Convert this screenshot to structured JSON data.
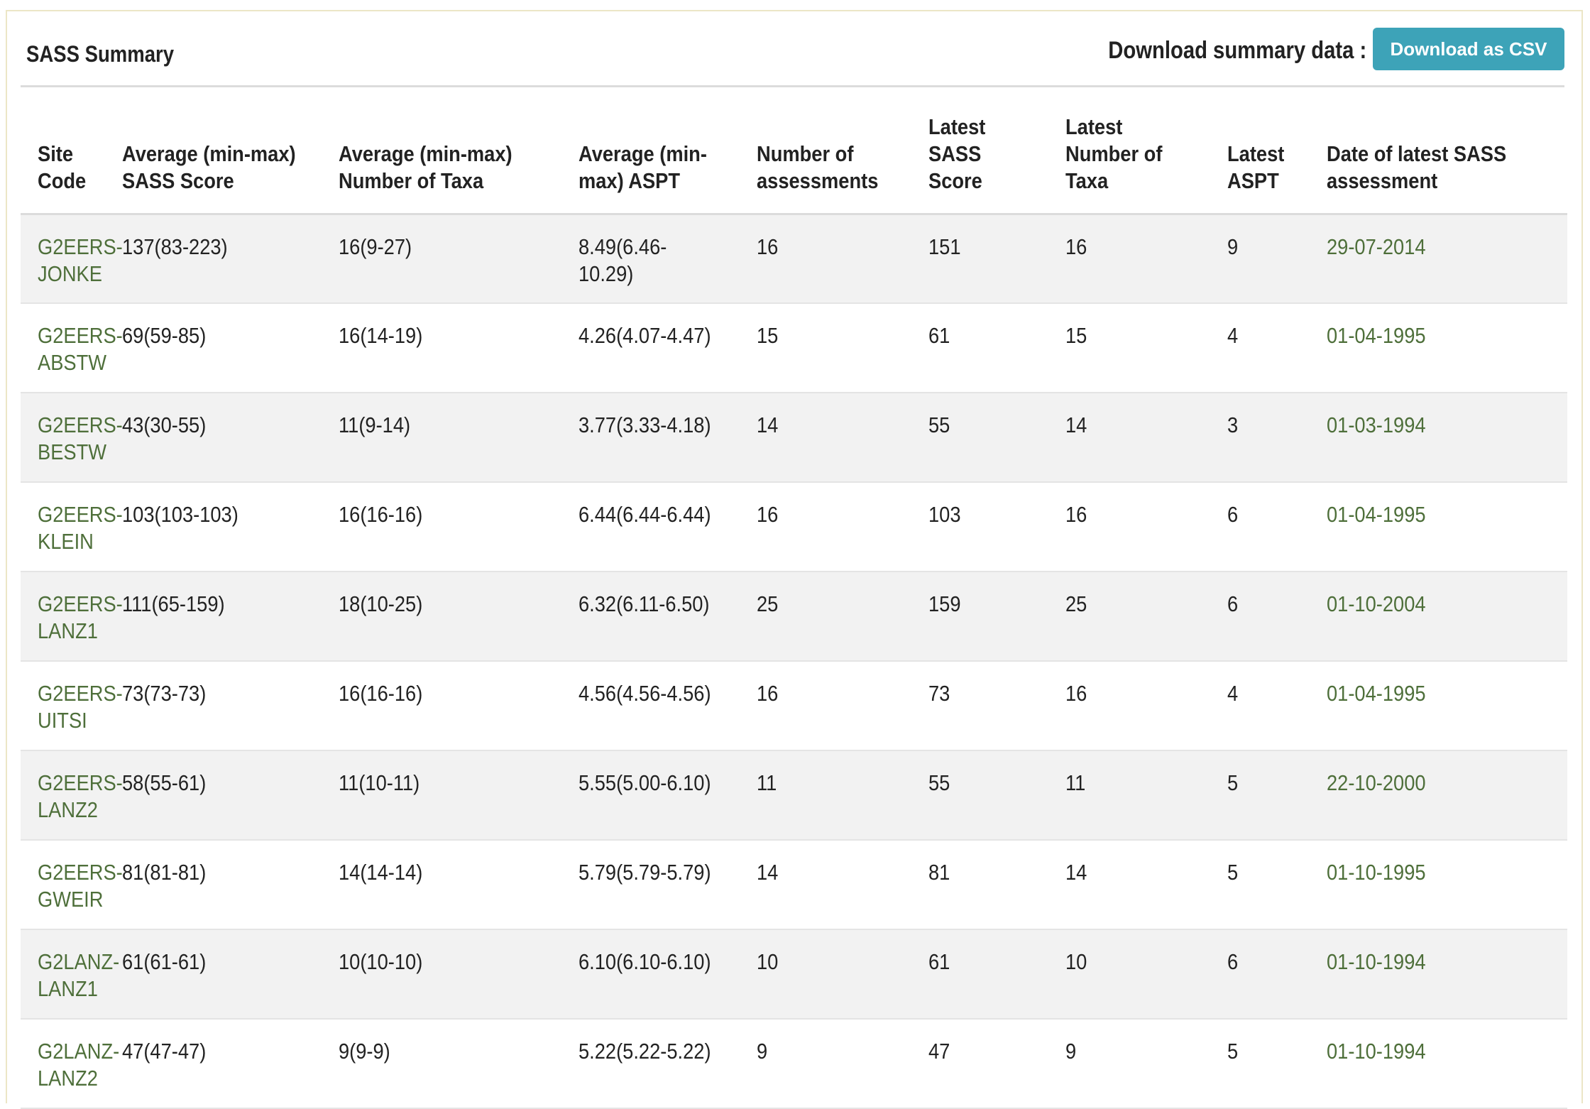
{
  "title": "SASS Summary",
  "download": {
    "label": "Download summary data :",
    "button": "Download as CSV"
  },
  "colors": {
    "link": "#4e6f3a",
    "button": "#3da3b8",
    "row_alt": "#f2f2f2"
  },
  "table": {
    "headers": [
      "Site Code",
      "Average (min-max) SASS Score",
      "Average (min-max) Number of Taxa",
      "Average (min-max) ASPT",
      "Number of assessments",
      "Latest SASS Score",
      "Latest Number of Taxa",
      "Latest ASPT",
      "Date of latest SASS assessment"
    ],
    "rows": [
      {
        "site": "G2EERS-JONKE",
        "avg_sass": "137(83-223)",
        "avg_taxa": "16(9-27)",
        "avg_aspt": "8.49(6.46-10.29)",
        "num": "16",
        "latest_sass": "151",
        "latest_taxa": "16",
        "latest_aspt": "9",
        "date": "29-07-2014"
      },
      {
        "site": "G2EERS-ABSTW",
        "avg_sass": "69(59-85)",
        "avg_taxa": "16(14-19)",
        "avg_aspt": "4.26(4.07-4.47)",
        "num": "15",
        "latest_sass": "61",
        "latest_taxa": "15",
        "latest_aspt": "4",
        "date": "01-04-1995"
      },
      {
        "site": "G2EERS-BESTW",
        "avg_sass": "43(30-55)",
        "avg_taxa": "11(9-14)",
        "avg_aspt": "3.77(3.33-4.18)",
        "num": "14",
        "latest_sass": "55",
        "latest_taxa": "14",
        "latest_aspt": "3",
        "date": "01-03-1994"
      },
      {
        "site": "G2EERS-KLEIN",
        "avg_sass": "103(103-103)",
        "avg_taxa": "16(16-16)",
        "avg_aspt": "6.44(6.44-6.44)",
        "num": "16",
        "latest_sass": "103",
        "latest_taxa": "16",
        "latest_aspt": "6",
        "date": "01-04-1995"
      },
      {
        "site": "G2EERS-LANZ1",
        "avg_sass": "111(65-159)",
        "avg_taxa": "18(10-25)",
        "avg_aspt": "6.32(6.11-6.50)",
        "num": "25",
        "latest_sass": "159",
        "latest_taxa": "25",
        "latest_aspt": "6",
        "date": "01-10-2004"
      },
      {
        "site": "G2EERS-UITSI",
        "avg_sass": "73(73-73)",
        "avg_taxa": "16(16-16)",
        "avg_aspt": "4.56(4.56-4.56)",
        "num": "16",
        "latest_sass": "73",
        "latest_taxa": "16",
        "latest_aspt": "4",
        "date": "01-04-1995"
      },
      {
        "site": "G2EERS-LANZ2",
        "avg_sass": "58(55-61)",
        "avg_taxa": "11(10-11)",
        "avg_aspt": "5.55(5.00-6.10)",
        "num": "11",
        "latest_sass": "55",
        "latest_taxa": "11",
        "latest_aspt": "5",
        "date": "22-10-2000"
      },
      {
        "site": "G2EERS-GWEIR",
        "avg_sass": "81(81-81)",
        "avg_taxa": "14(14-14)",
        "avg_aspt": "5.79(5.79-5.79)",
        "num": "14",
        "latest_sass": "81",
        "latest_taxa": "14",
        "latest_aspt": "5",
        "date": "01-10-1995"
      },
      {
        "site": "G2LANZ-LANZ1",
        "avg_sass": "61(61-61)",
        "avg_taxa": "10(10-10)",
        "avg_aspt": "6.10(6.10-6.10)",
        "num": "10",
        "latest_sass": "61",
        "latest_taxa": "10",
        "latest_aspt": "6",
        "date": "01-10-1994"
      },
      {
        "site": "G2LANZ-LANZ2",
        "avg_sass": "47(47-47)",
        "avg_taxa": "9(9-9)",
        "avg_aspt": "5.22(5.22-5.22)",
        "num": "9",
        "latest_sass": "47",
        "latest_taxa": "9",
        "latest_aspt": "5",
        "date": "01-10-1994"
      }
    ]
  }
}
